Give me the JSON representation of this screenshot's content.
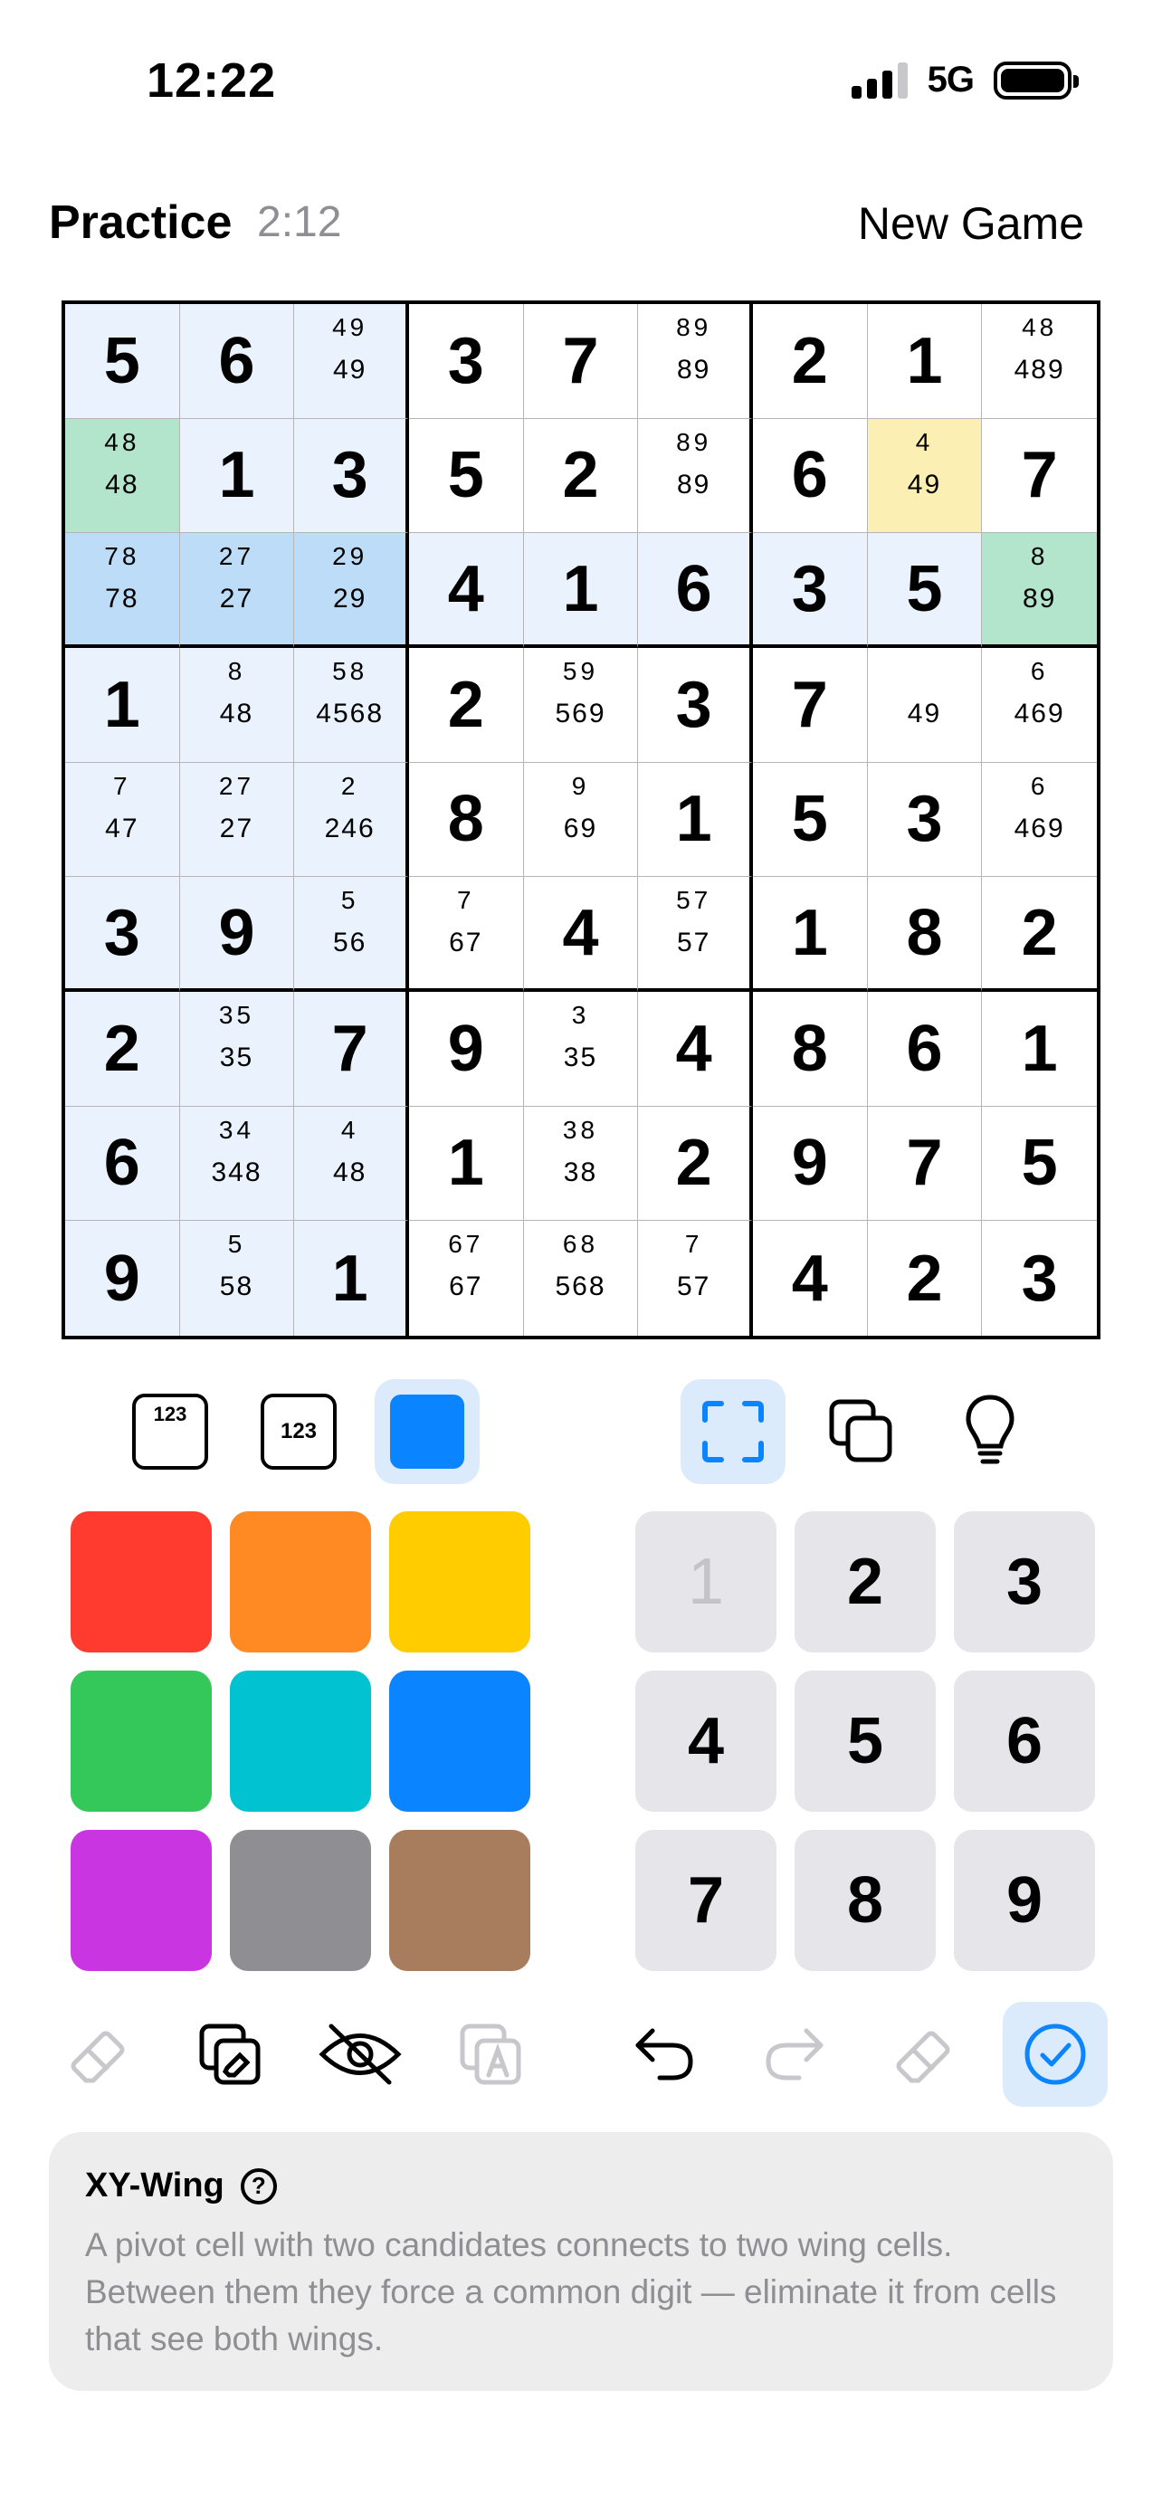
{
  "status": {
    "time": "12:22",
    "network": "5G"
  },
  "header": {
    "title": "Practice",
    "timer": "2:12",
    "new_game": "New Game"
  },
  "colors": {
    "highlight": "#eaf3fd",
    "selected": "#bcdcf8",
    "pair_green": "#b3e5cc",
    "pair_yellow": "#fcefb3",
    "accent": "#0a84ff"
  },
  "grid": [
    [
      {
        "v": "5",
        "bg": "h"
      },
      {
        "v": "6",
        "bg": "h"
      },
      {
        "t": "49",
        "c": "49",
        "bg": "h"
      },
      {
        "v": "3"
      },
      {
        "v": "7"
      },
      {
        "t": "89",
        "c": "89"
      },
      {
        "v": "2"
      },
      {
        "v": "1"
      },
      {
        "t": "48",
        "c": "489"
      }
    ],
    [
      {
        "t": "48",
        "c": "48",
        "bg": "g"
      },
      {
        "v": "1",
        "bg": "h"
      },
      {
        "v": "3",
        "bg": "h"
      },
      {
        "v": "5"
      },
      {
        "v": "2"
      },
      {
        "t": "89",
        "c": "89"
      },
      {
        "v": "6"
      },
      {
        "t": "4",
        "c": "49",
        "bg": "y"
      },
      {
        "v": "7"
      }
    ],
    [
      {
        "t": "78",
        "c": "78",
        "bg": "s"
      },
      {
        "t": "27",
        "c": "27",
        "bg": "s"
      },
      {
        "t": "29",
        "c": "29",
        "bg": "s"
      },
      {
        "v": "4",
        "bg": "h"
      },
      {
        "v": "1",
        "bg": "h"
      },
      {
        "v": "6",
        "bg": "h"
      },
      {
        "v": "3",
        "bg": "h"
      },
      {
        "v": "5",
        "bg": "h"
      },
      {
        "t": "8",
        "c": "89",
        "bg": "g"
      }
    ],
    [
      {
        "v": "1",
        "bg": "h"
      },
      {
        "t": "8",
        "c": "48",
        "bg": "h"
      },
      {
        "t": "58",
        "c": "4568",
        "bg": "h"
      },
      {
        "v": "2"
      },
      {
        "t": "59",
        "c": "569"
      },
      {
        "v": "3"
      },
      {
        "v": "7"
      },
      {
        "c": "49"
      },
      {
        "t": "6",
        "c": "469"
      }
    ],
    [
      {
        "t": "7",
        "c": "47",
        "bg": "h"
      },
      {
        "t": "27",
        "c": "27",
        "bg": "h"
      },
      {
        "t": "2",
        "c": "246",
        "bg": "h"
      },
      {
        "v": "8"
      },
      {
        "t": "9",
        "c": "69"
      },
      {
        "v": "1"
      },
      {
        "v": "5"
      },
      {
        "v": "3"
      },
      {
        "t": "6",
        "c": "469"
      }
    ],
    [
      {
        "v": "3",
        "bg": "h"
      },
      {
        "v": "9",
        "bg": "h"
      },
      {
        "t": "5",
        "c": "56",
        "bg": "h"
      },
      {
        "t": "7",
        "c": "67"
      },
      {
        "v": "4"
      },
      {
        "t": "57",
        "c": "57"
      },
      {
        "v": "1"
      },
      {
        "v": "8"
      },
      {
        "v": "2"
      }
    ],
    [
      {
        "v": "2",
        "bg": "h"
      },
      {
        "t": "35",
        "c": "35",
        "bg": "h"
      },
      {
        "v": "7",
        "bg": "h"
      },
      {
        "v": "9"
      },
      {
        "t": "3",
        "c": "35"
      },
      {
        "v": "4"
      },
      {
        "v": "8"
      },
      {
        "v": "6"
      },
      {
        "v": "1"
      }
    ],
    [
      {
        "v": "6",
        "bg": "h"
      },
      {
        "t": "34",
        "c": "348",
        "bg": "h"
      },
      {
        "t": "4",
        "c": "48",
        "bg": "h"
      },
      {
        "v": "1"
      },
      {
        "t": "38",
        "c": "38"
      },
      {
        "v": "2"
      },
      {
        "v": "9"
      },
      {
        "v": "7"
      },
      {
        "v": "5"
      }
    ],
    [
      {
        "v": "9",
        "bg": "h"
      },
      {
        "t": "5",
        "c": "58",
        "bg": "h"
      },
      {
        "v": "1",
        "bg": "h"
      },
      {
        "t": "67",
        "c": "67"
      },
      {
        "t": "68",
        "c": "568"
      },
      {
        "t": "7",
        "c": "57"
      },
      {
        "v": "4"
      },
      {
        "v": "2"
      },
      {
        "v": "3"
      }
    ]
  ],
  "modes": {
    "corner_label": "123",
    "center_label": "123"
  },
  "palette": [
    "#ff3b30",
    "#ff8a24",
    "#ffcc00",
    "#34c759",
    "#00c2d1",
    "#0a84ff",
    "#c935e0",
    "#8e8e93",
    "#a87d5e"
  ],
  "numpad": [
    "1",
    "2",
    "3",
    "4",
    "5",
    "6",
    "7",
    "8",
    "9"
  ],
  "hint": {
    "title": "XY-Wing",
    "body": "A pivot cell with two candidates connects to two wing cells. Between them they force a common digit — eliminate it from cells that see both wings."
  }
}
